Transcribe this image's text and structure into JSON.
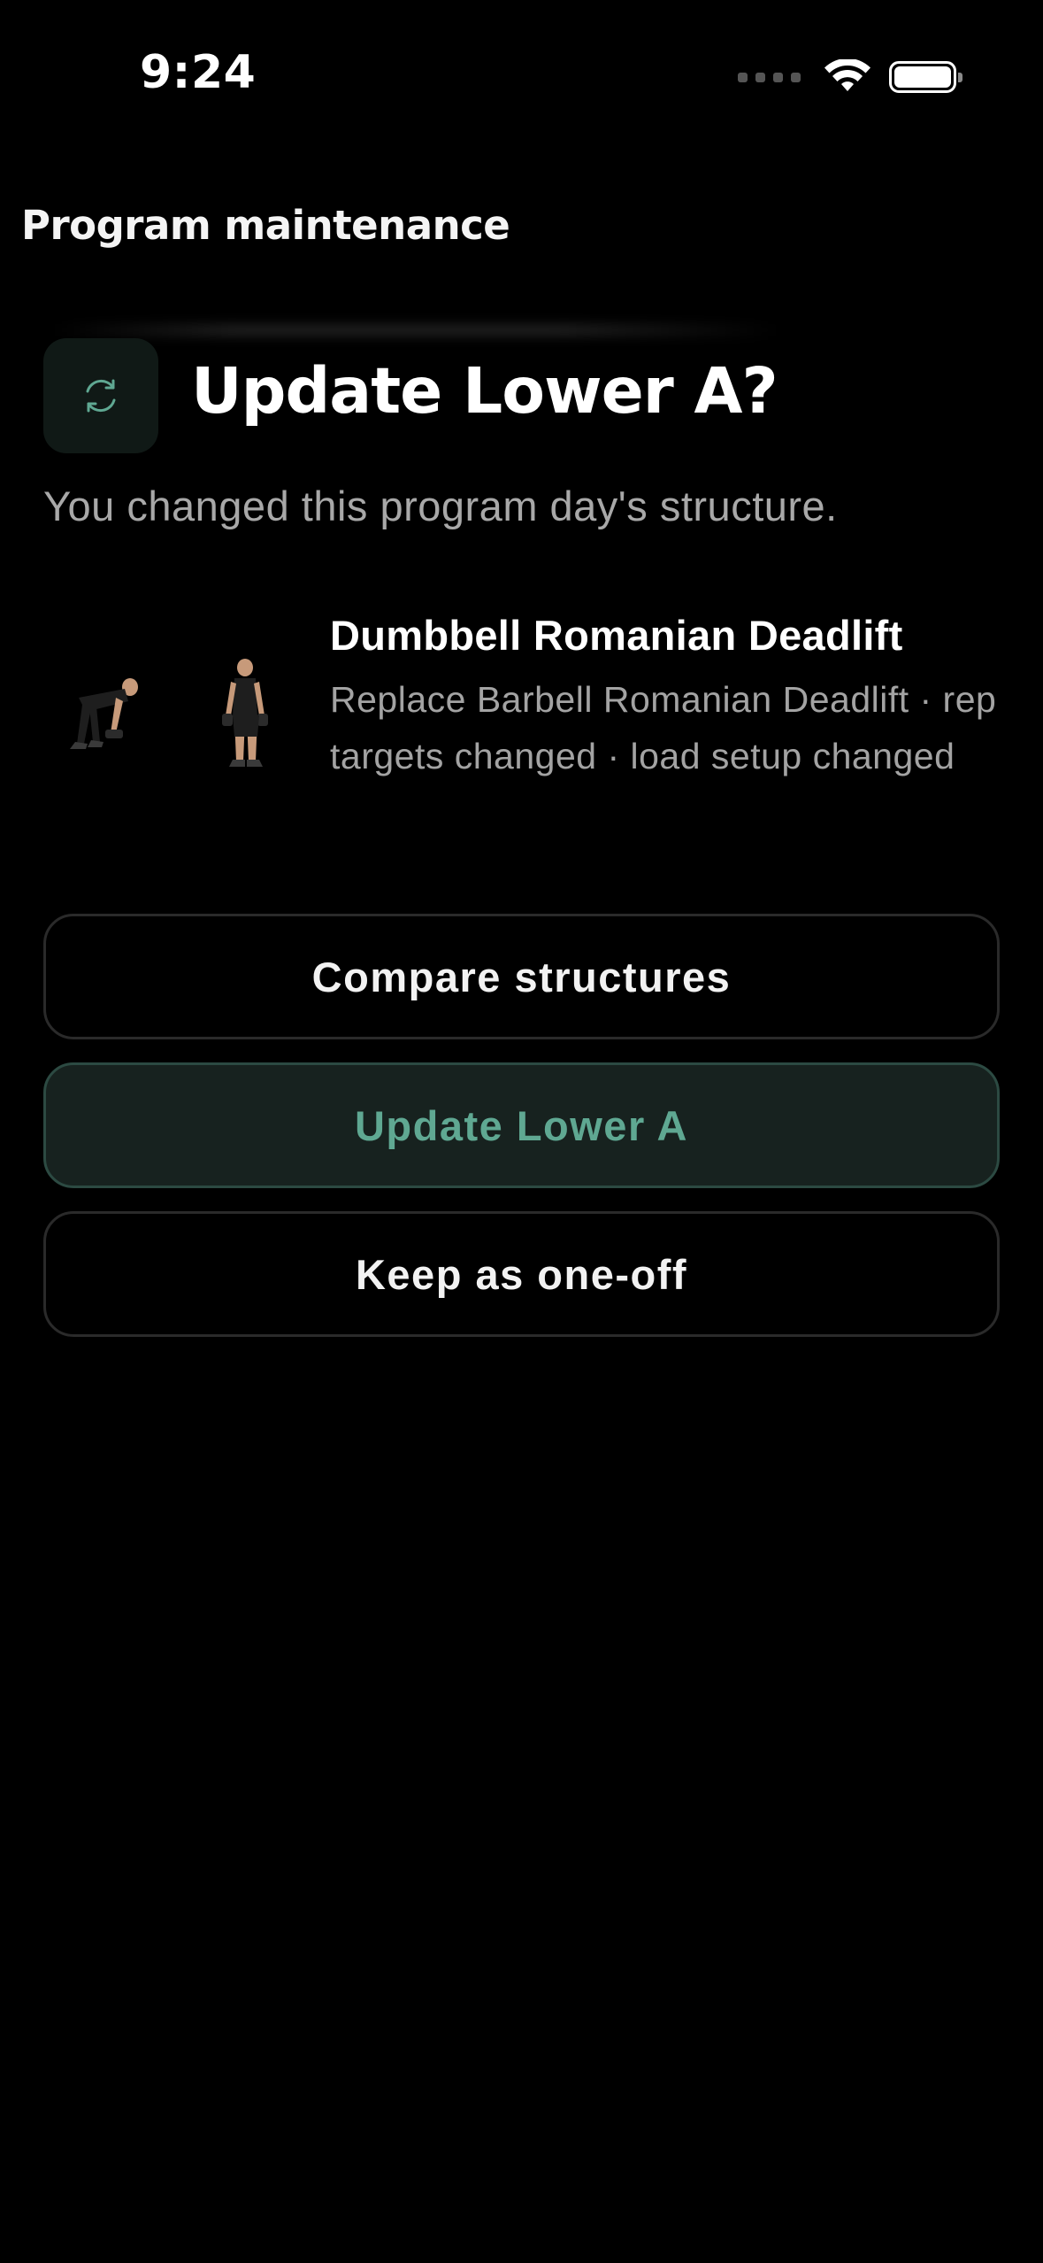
{
  "status_bar": {
    "time": "9:24"
  },
  "header": {
    "title": "Program maintenance"
  },
  "dialog": {
    "title": "Update Lower A?",
    "subtitle": "You changed this program day's structure.",
    "icon": "sync-icon"
  },
  "exercise": {
    "name": "Dumbbell Romanian Deadlift",
    "detail": "Replace Barbell Romanian Deadlift · rep targets changed · load setup changed"
  },
  "actions": {
    "compare_label": "Compare structures",
    "update_label": "Update Lower A",
    "keep_label": "Keep as one-off"
  },
  "colors": {
    "background": "#000000",
    "accent": "#5fa892",
    "accent_bg": "#17221f",
    "border": "#2a2a2a",
    "muted_text": "#a8a8a8"
  }
}
